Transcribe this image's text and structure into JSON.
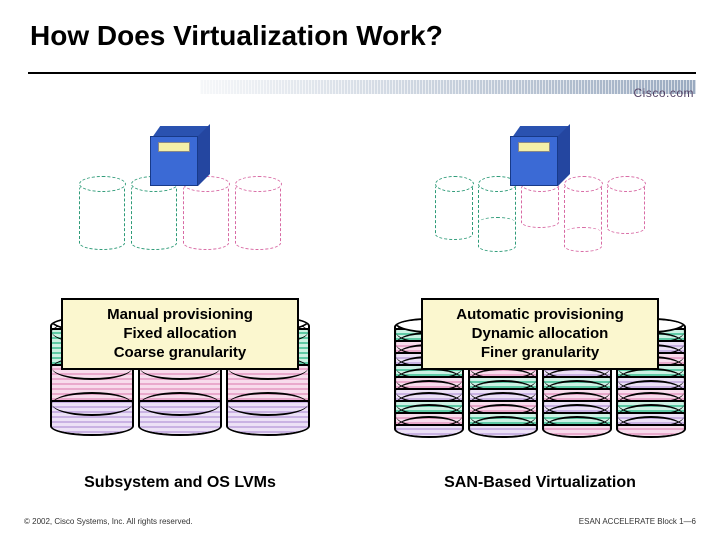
{
  "title": "How Does Virtualization Work?",
  "logo": "Cisco.com",
  "left": {
    "box_l1": "Manual provisioning",
    "box_l2": "Fixed allocation",
    "box_l3": "Coarse granularity",
    "caption": "Subsystem and OS LVMs"
  },
  "right": {
    "box_l1": "Automatic provisioning",
    "box_l2": "Dynamic allocation",
    "box_l3": "Finer granularity",
    "caption": "SAN-Based Virtualization"
  },
  "footer": {
    "copyright": "© 2002, Cisco Systems, Inc. All rights reserved.",
    "pager": "ESAN ACCELERATE Block 1—6"
  }
}
